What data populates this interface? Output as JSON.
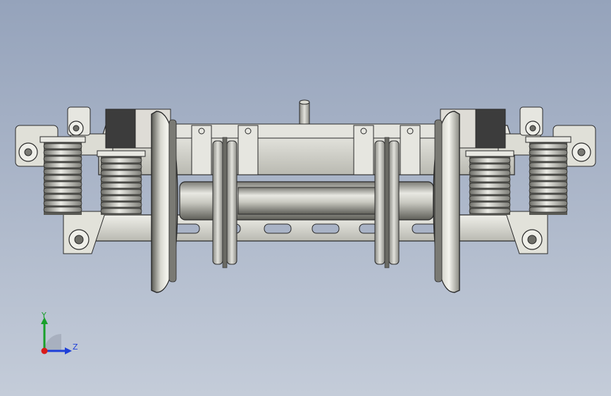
{
  "viewport": {
    "background_top": "#95a3bb",
    "background_bottom": "#c4ccd9",
    "model_name": "bogie-assembly"
  },
  "triad": {
    "x_axis": {
      "label": "",
      "color": "#d91a1a"
    },
    "y_axis": {
      "label": "Y",
      "color": "#18a02a"
    },
    "z_axis": {
      "label": "Z",
      "color": "#1e3fd8"
    }
  },
  "colors": {
    "metal_light": "#e6e6e0",
    "metal_mid": "#bcbcb4",
    "metal_dark": "#6e6e68",
    "outline": "#2a2a2a",
    "block_dark": "#3c3c3c"
  }
}
